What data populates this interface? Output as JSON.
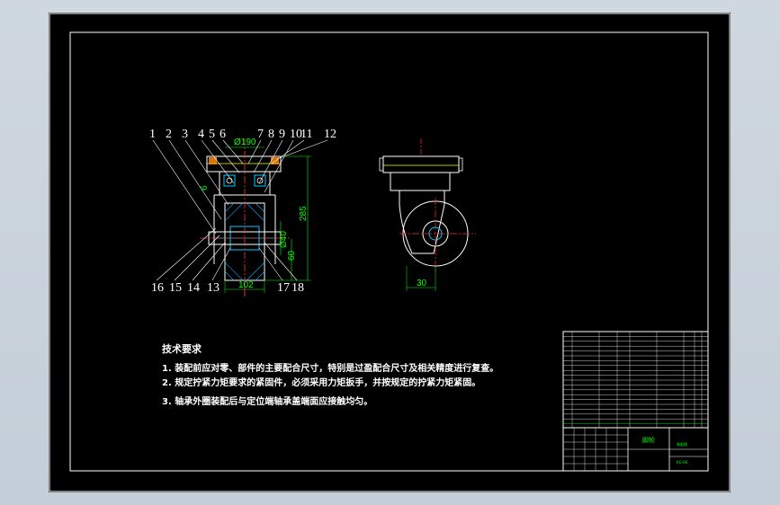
{
  "balloons": {
    "top": [
      "1",
      "2",
      "3",
      "4",
      "5",
      "6",
      "7",
      "8",
      "9",
      "10",
      "11",
      "12"
    ],
    "bottom": [
      "16",
      "15",
      "14",
      "13",
      "17",
      "18"
    ]
  },
  "dimensions": {
    "diameter_top": "Ø190",
    "height_total": "285",
    "width_bottom": "102",
    "d_shaft": "Ø40",
    "h_lower": "60",
    "side_gap": "30",
    "small_left": "6"
  },
  "tech_requirements": {
    "title": "技术要求",
    "items": [
      "1. 装配前应对零、部件的主要配合尺寸，特别是过盈配合尺寸及相关精度进行复查。",
      "2. 规定拧紧力矩要求的紧固件，必须采用力矩扳手，并按规定的拧紧力矩紧固。",
      "3. 轴承外圈装配后与定位端轴承盖端面应接触均匀。"
    ]
  },
  "title_block": {
    "drawing_name": "脚轮",
    "material_cell": "装配图",
    "code_cell": "KG-00"
  },
  "colors": {
    "frame": "#ffffff",
    "outline": "#ffffff",
    "hidden": "#ffff00",
    "dimension": "#00ff00",
    "center": "#ff3030",
    "section": "#00ccff",
    "part": "#ff8800",
    "hatch": "#00aaff"
  }
}
